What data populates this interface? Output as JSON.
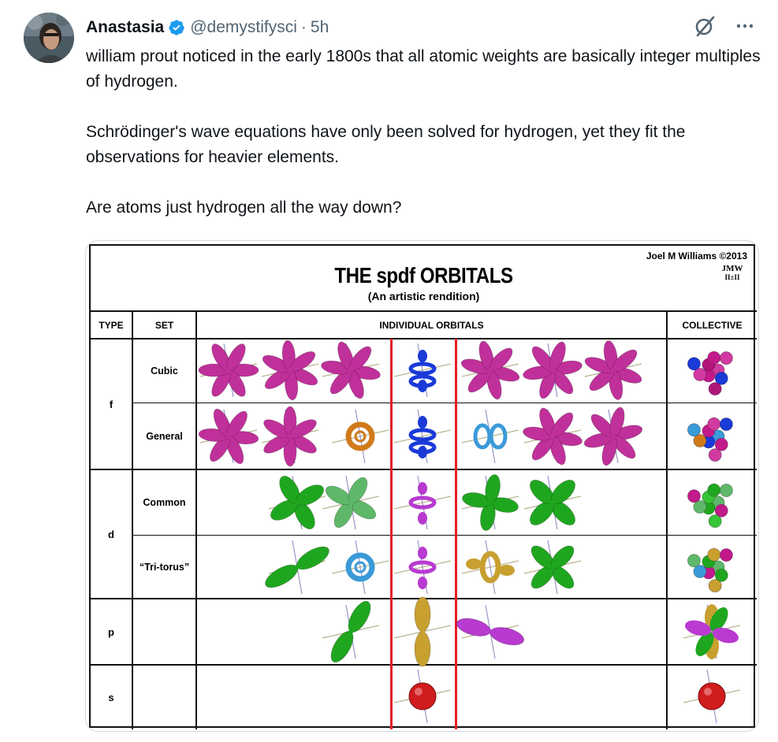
{
  "author": {
    "name": "Anastasia",
    "handle": "@demystifysci",
    "separator": "·",
    "time": "5h"
  },
  "tweet": {
    "line1": "william prout noticed in the early 1800s that all atomic weights are basically integer multiples of hydrogen.",
    "line2": "Schrödinger's wave equations have only been solved for hydrogen, yet they fit the observations for heavier elements.",
    "line3": "Are atoms just hydrogen all the way down?"
  },
  "icons": [
    "verified-badge-icon",
    "grok-icon",
    "more-icon"
  ],
  "colors": {
    "verified": "#1d9bf0",
    "muted": "#536471",
    "red_divider": "#e41e26"
  },
  "image": {
    "title": "THE spdf ORBITALS",
    "subtitle": "(An  artistic rendition)",
    "author": "Joel M Williams  ©2013",
    "headers": {
      "type": "TYPE",
      "set": "SET",
      "individual": "INDIVIDUAL ORBITALS",
      "collective": "COLLECTIVE"
    },
    "types": {
      "f": "f",
      "d": "d",
      "p": "p",
      "s": "s"
    },
    "sets": {
      "cubic": "Cubic",
      "general": "General",
      "common": "Common",
      "tritorus": "“Tri-torus”"
    }
  }
}
